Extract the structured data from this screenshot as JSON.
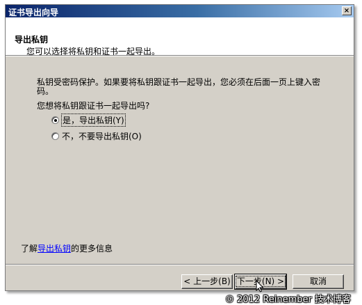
{
  "window": {
    "title": "证书导出向导",
    "close_glyph": "×"
  },
  "header": {
    "title": "导出私钥",
    "subtitle": "您可以选择将私钥和证书一起导出。"
  },
  "body": {
    "description_line1": "私钥受密码保护。如果要将私钥跟证书一起导出，您必须在后面一页上键入密",
    "description_line2": "码。",
    "question": "您想将私钥跟证书一起导出吗?",
    "options": [
      {
        "label": "是，导出私钥(Y)",
        "checked": true
      },
      {
        "label": "不，不要导出私钥(O)",
        "checked": false
      }
    ],
    "more_info_prefix": "了解",
    "more_info_link": "导出私钥",
    "more_info_suffix": "的更多信息"
  },
  "buttons": {
    "back": "< 上一步(B)",
    "next": "下一步(N) >",
    "cancel": "取消"
  },
  "watermark": "© 2012 Reinember 技术博客"
}
